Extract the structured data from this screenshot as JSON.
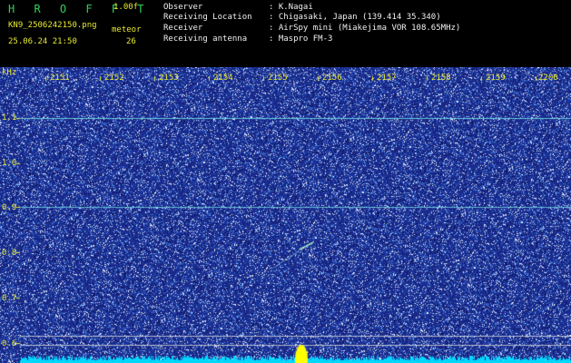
{
  "header": {
    "app_name": "H R O F F T",
    "version": "1.00f",
    "filename": "KN9_2506242150.png",
    "program": "meteor",
    "datetime": "25.06.24 21:50",
    "count": "26",
    "info_labels": [
      "Observer",
      "Receiving Location",
      "Receiver",
      "Receiving antenna"
    ],
    "info_values": [
      ": K.Nagai",
      ": Chigasaki, Japan (139.414 35.340)",
      ": AirSpy mini (Miakejima VOR 108.65MHz)",
      ": Maspro FM-3"
    ]
  },
  "axis": {
    "y_unit": "kHz",
    "y_labels": [
      "1.1",
      "1.0",
      "0.9",
      "0.8",
      "0.7",
      "0.6"
    ],
    "x_labels": [
      "2151",
      "2152",
      "2153",
      "2154",
      "2155",
      "2156",
      "2157",
      "2158",
      "2159",
      "2200"
    ]
  },
  "colors": {
    "background": "#1a2a8c",
    "label": "#e8e830",
    "logo": "#2fd05a",
    "baseline": "#00d8ff",
    "burst": "#ffff00"
  }
}
